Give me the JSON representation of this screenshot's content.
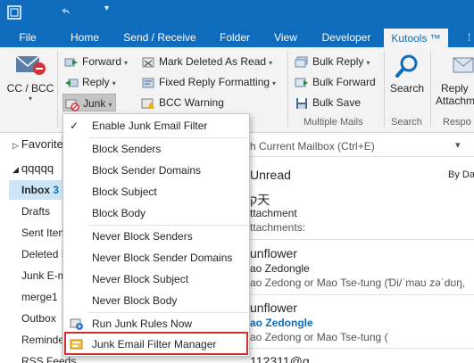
{
  "ribbon_tabs": [
    "File",
    "Home",
    "Send / Receive",
    "Folder",
    "View",
    "Developer",
    "Kutools ™"
  ],
  "ribbon": {
    "cc_bcc": "CC / BCC",
    "forward": "Forward",
    "reply": "Reply",
    "junk": "Junk",
    "mark_deleted_as_read": "Mark Deleted As Read",
    "fixed_reply_formatting": "Fixed Reply Formatting",
    "bcc_warning": "BCC Warning",
    "bulk_reply": "Bulk Reply",
    "bulk_forward": "Bulk Forward",
    "bulk_save": "Bulk Save",
    "group_multiple_mails": "Multiple Mails",
    "search": "Search",
    "group_search": "Search",
    "reply_attachments": "Reply",
    "reply_attachments_2": "Attachm",
    "group_respo": "Respo"
  },
  "folders": {
    "favorites": "Favorite",
    "account": "qqqqq",
    "inbox": "Inbox",
    "inbox_count": "3",
    "drafts": "Drafts",
    "sent": "Sent Item",
    "deleted": "Deleted I",
    "junk": "Junk E-m",
    "merge": "merge1",
    "outbox": "Outbox",
    "reminders": "Reminde",
    "rss": "RSS Feeds"
  },
  "msglist": {
    "search_placeholder": "h Current Mailbox (Ctrl+E)",
    "unread": "Unread",
    "sort": "By Dat",
    "m1_line1": "ק天",
    "m1_line2": "ttachment",
    "m1_line3": "ttachments:",
    "m2_line1": "unflower",
    "m2_line2": "ao Zedongle",
    "m2_line3": "ao Zedong or Mao Tse-tung (Ɗi/ˈmaʊ zəˈdʊŋ,",
    "m3_line1": "unflower",
    "m3_line2": "ao Zedongle",
    "m3_line3": "ao Zedong or Mao Tse-tung (",
    "m4_line1": "112311@q"
  },
  "menu": {
    "enable_filter": "Enable Junk Email Filter",
    "block_senders": "Block Senders",
    "block_sender_domains": "Block Sender Domains",
    "block_subject": "Block Subject",
    "block_body": "Block Body",
    "never_block_senders": "Never Block Senders",
    "never_block_sender_domains": "Never Block Sender Domains",
    "never_block_subject": "Never Block Subject",
    "never_block_body": "Never Block Body",
    "run_junk_rules_now": "Run Junk Rules Now",
    "junk_filter_manager": "Junk Email Filter Manager"
  },
  "colors": {
    "brand": "#0f6cbd",
    "highlight_border": "#d32f2f",
    "selection": "#cde6f7"
  }
}
